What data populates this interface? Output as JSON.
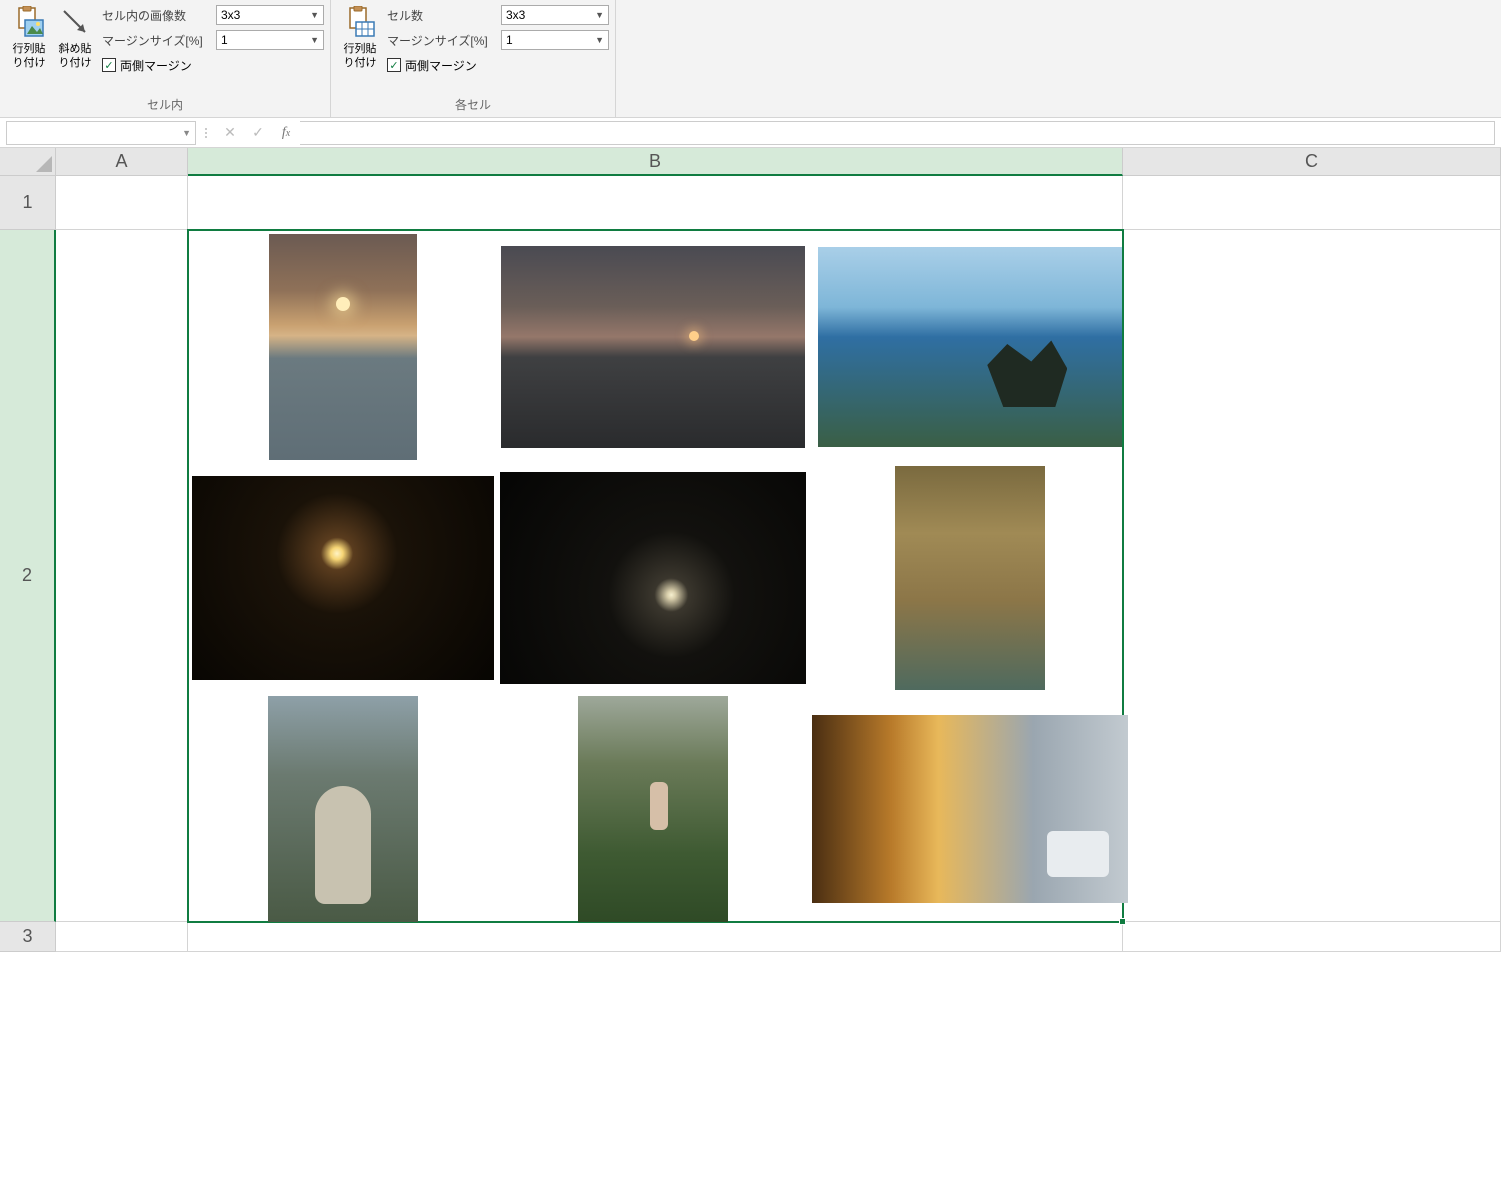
{
  "ribbon": {
    "group1": {
      "label": "セル内",
      "paste_btn": "行列貼\nり付け",
      "diag_btn": "斜め貼\nり付け",
      "row_images_label": "セル内の画像数",
      "row_images_value": "3x3",
      "margin_label": "マージンサイズ[%]",
      "margin_value": "1",
      "both_margin_label": "両側マージン"
    },
    "group2": {
      "label": "各セル",
      "paste_btn": "行列貼\nり付け",
      "cells_label": "セル数",
      "cells_value": "3x3",
      "margin_label": "マージンサイズ[%]",
      "margin_value": "1",
      "both_margin_label": "両側マージン"
    }
  },
  "formula_bar": {
    "name_box_value": "",
    "formula_value": ""
  },
  "grid": {
    "columns": [
      "A",
      "B",
      "C"
    ],
    "rows": [
      "1",
      "2",
      "3"
    ],
    "selected_cell": "B2"
  }
}
